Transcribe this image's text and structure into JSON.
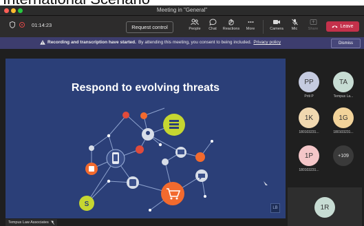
{
  "cropped_header_text": "International Scenario",
  "window": {
    "title": "Meeting in \"General\""
  },
  "toolbar": {
    "timer": "01:14:23",
    "request_control": "Request control",
    "buttons": [
      {
        "label": "People",
        "icon": "people-icon"
      },
      {
        "label": "Chat",
        "icon": "chat-icon"
      },
      {
        "label": "Reactions",
        "icon": "reactions-icon"
      },
      {
        "label": "More",
        "icon": "more-icon"
      },
      {
        "label": "Camera",
        "icon": "camera-icon"
      },
      {
        "label": "Mic",
        "icon": "mic-off-icon"
      },
      {
        "label": "Share",
        "icon": "share-icon"
      }
    ],
    "leave": "Leave"
  },
  "banner": {
    "bold_text": "Recording and transcription have started.",
    "text": "By attending this meeting, you consent to being included.",
    "link": "Privacy policy",
    "dismiss": "Dismiss"
  },
  "stage": {
    "slide_title": "Respond to evolving threats",
    "presenter_label": "Tempus Law Associates",
    "watermark": "LB"
  },
  "participants": [
    {
      "initials": "PP",
      "name": "Priti P",
      "color": "#c5cbe0"
    },
    {
      "initials": "TA",
      "name": "Tempus La...",
      "color": "#c7dcd3"
    },
    {
      "initials": "1K",
      "name": "180103231...",
      "color": "#f0d8b0"
    },
    {
      "initials": "1G",
      "name": "180103231...",
      "color": "#f2d39a"
    },
    {
      "initials": "1P",
      "name": "180103231...",
      "color": "#f4c6c8"
    },
    {
      "initials": "+109",
      "name": "",
      "color": "#3a3a3a"
    }
  ],
  "self_tile": {
    "initials": "1R",
    "color": "#c7dcd3"
  },
  "colors": {
    "leave": "#c4314b",
    "banner": "#3d3d6e",
    "slide_bg": "#2b3f78",
    "accent_orange": "#f26a2e",
    "accent_lime": "#c6d631"
  }
}
